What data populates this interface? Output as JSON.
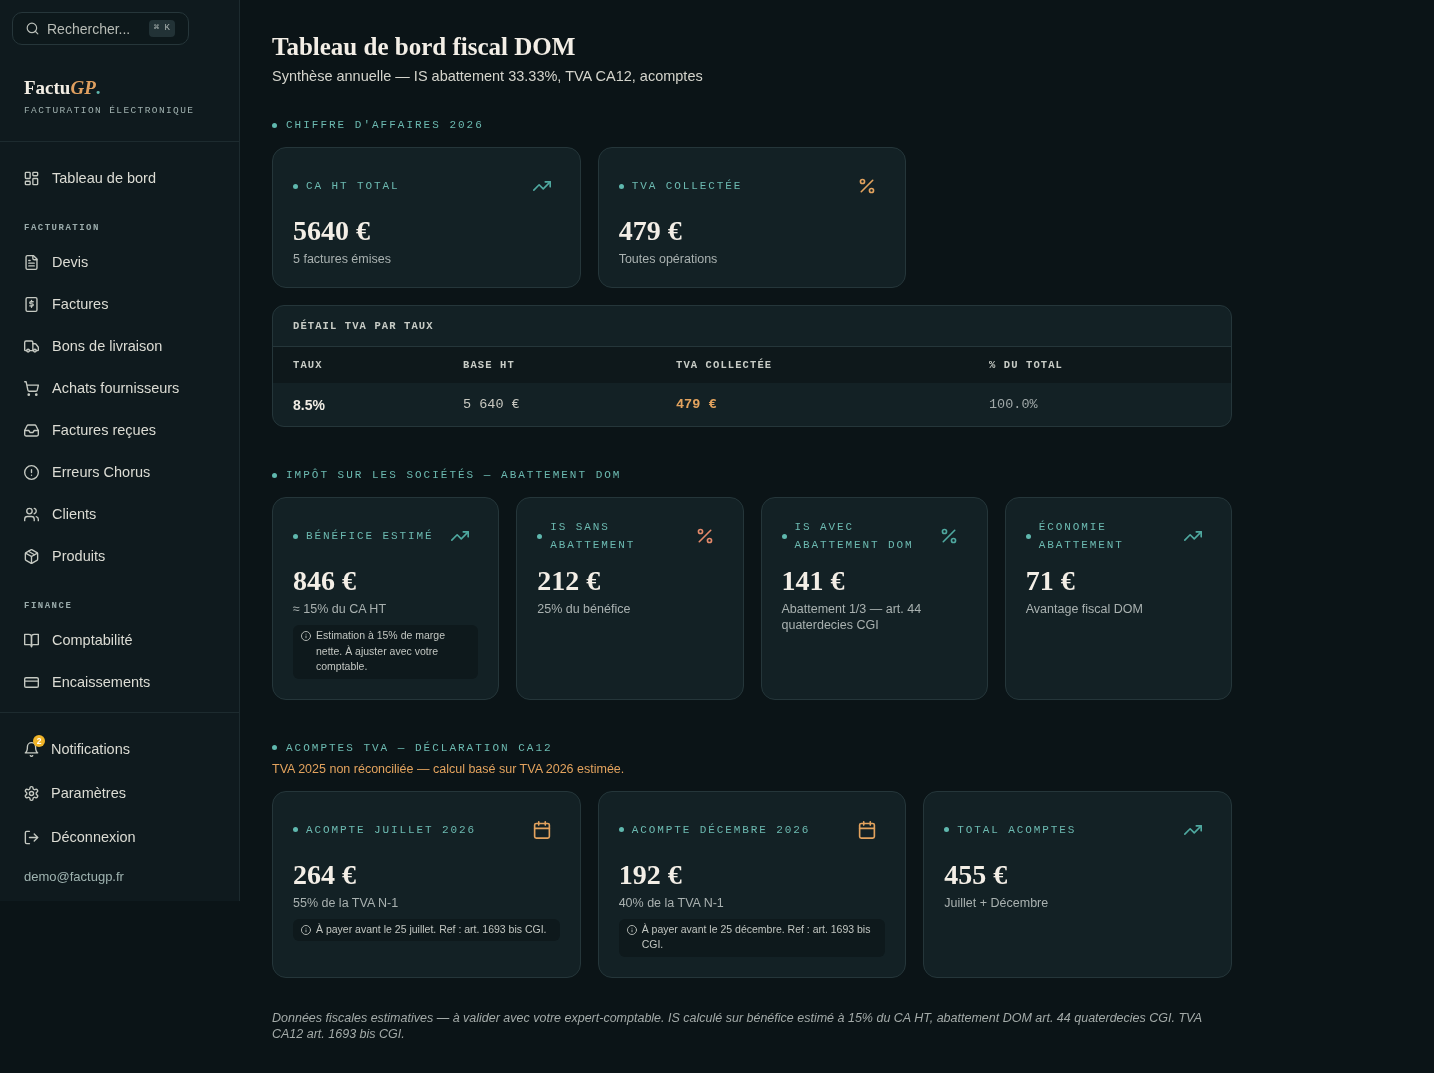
{
  "sidebar": {
    "search": {
      "placeholder": "Rechercher...",
      "shortcut": "⌘ K"
    },
    "brand": {
      "name": "Factu",
      "accent": "GP",
      "mark": ".",
      "tagline": "FACTURATION ÉLECTRONIQUE"
    },
    "nav_groups": [
      {
        "items": [
          {
            "label": "Tableau de bord",
            "selected": false
          }
        ]
      },
      {
        "heading": "FACTURATION",
        "items": [
          {
            "label": "Devis",
            "selected": false
          },
          {
            "label": "Factures",
            "selected": false
          },
          {
            "label": "Bons de livraison",
            "selected": false
          },
          {
            "label": "Achats fournisseurs",
            "selected": false
          },
          {
            "label": "Factures reçues",
            "selected": false
          },
          {
            "label": "Erreurs Chorus",
            "selected": false
          },
          {
            "label": "Clients",
            "selected": false
          },
          {
            "label": "Produits",
            "selected": false
          }
        ]
      },
      {
        "heading": "FINANCE",
        "items": [
          {
            "label": "Comptabilité",
            "selected": false
          },
          {
            "label": "Encaissements",
            "selected": false
          }
        ]
      }
    ],
    "account_items": [
      {
        "label": "Notifications",
        "badge": "2",
        "selected": false
      },
      {
        "label": "Paramètres",
        "selected": false
      },
      {
        "label": "Déconnexion",
        "selected": false
      }
    ],
    "user_email": "demo@factugp.fr"
  },
  "page": {
    "title": "Tableau de bord fiscal DOM",
    "subtitle": "Synthèse annuelle — IS abattement 33.33%, TVA CA12, acomptes"
  },
  "sections": [
    {
      "heading": "CHIFFRE D'AFFAIRES 2026",
      "cards": [
        {
          "label": "CA HT TOTAL",
          "value": "5640 €",
          "note": "5 factures émises"
        },
        {
          "label": "TVA COLLECTÉE",
          "value": "479 €",
          "note": "Toutes opérations"
        }
      ],
      "table": {
        "title": "DÉTAIL TVA PAR TAUX",
        "columns": [
          "TAUX",
          "BASE HT",
          "TVA COLLECTÉE",
          "% DU TOTAL"
        ],
        "rows": [
          [
            "8.5%",
            "5 640 €",
            "479 €",
            "100.0%"
          ]
        ]
      }
    },
    {
      "heading": "IMPÔT SUR LES SOCIÉTÉS — ABATTEMENT DOM",
      "cards": [
        {
          "label": "BÉNÉFICE ESTIMÉ",
          "value": "846 €",
          "note": "≈ 15% du CA HT",
          "info": "Estimation à 15% de marge nette. À ajuster avec votre comptable."
        },
        {
          "label": "IS SANS ABATTEMENT",
          "value": "212 €",
          "note": "25% du bénéfice"
        },
        {
          "label": "IS AVEC ABATTEMENT DOM",
          "value": "141 €",
          "note": "Abattement 1/3 — art. 44 quaterdecies CGI"
        },
        {
          "label": "ÉCONOMIE ABATTEMENT",
          "value": "71 €",
          "note": "Avantage fiscal DOM"
        }
      ]
    },
    {
      "heading": "ACOMPTES TVA — DÉCLARATION CA12",
      "warning": "TVA 2025 non réconciliée — calcul basé sur TVA 2026 estimée.",
      "cards": [
        {
          "label": "ACOMPTE JUILLET 2026",
          "value": "264 €",
          "note": "55% de la TVA N-1",
          "info": "À payer avant le 25 juillet. Ref : art. 1693 bis CGI."
        },
        {
          "label": "ACOMPTE DÉCEMBRE 2026",
          "value": "192 €",
          "note": "40% de la TVA N-1",
          "info": "À payer avant le 25 décembre. Ref : art. 1693 bis CGI."
        },
        {
          "label": "TOTAL ACOMPTES",
          "value": "455 €",
          "note": "Juillet + Décembre"
        }
      ]
    }
  ],
  "footnote": "Données fiscales estimatives — à valider avec votre expert-comptable. IS calculé sur bénéfice estimé à 15% du CA HT, abattement DOM art. 44 quaterdecies CGI. TVA CA12 art. 1693 bis CGI."
}
